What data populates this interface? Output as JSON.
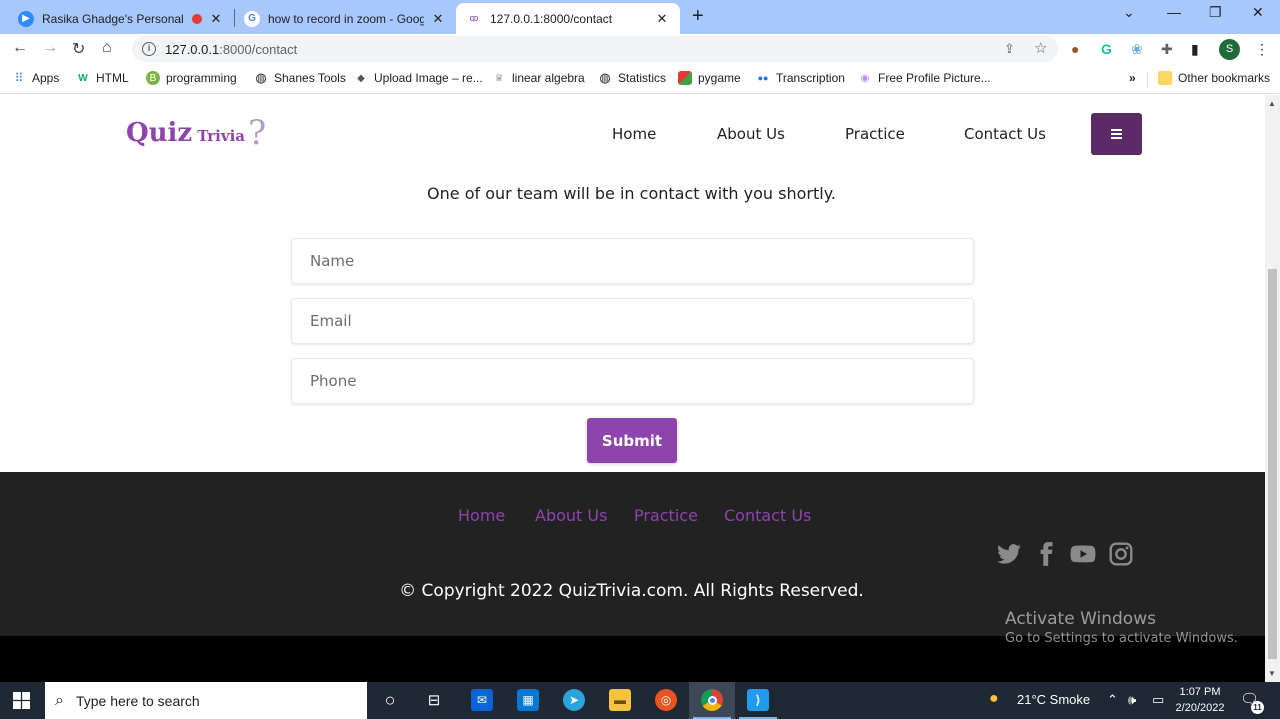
{
  "browser": {
    "tabs": [
      {
        "title": "Rasika Ghadge's Personal Me",
        "icon": "zoom-icon"
      },
      {
        "title": "how to record in zoom - Google",
        "icon": "google-icon"
      },
      {
        "title": "127.0.0.1:8000/contact",
        "icon": "site-favicon",
        "active": true
      }
    ],
    "new_tab": "+",
    "url_host": "127.0.0.1",
    "url_path": ":8000/contact",
    "profile_initial": "S",
    "bookmarks": [
      {
        "label": "Apps",
        "icon": "apps-grid-icon"
      },
      {
        "label": "HTML",
        "icon": "w3-icon"
      },
      {
        "label": "programming",
        "icon": "b-icon"
      },
      {
        "label": "Shanes Tools",
        "icon": "globe-icon"
      },
      {
        "label": "Upload Image – re...",
        "icon": "upload-icon"
      },
      {
        "label": "linear algebra",
        "icon": "crown-icon"
      },
      {
        "label": "Statistics",
        "icon": "globe-icon"
      },
      {
        "label": "pygame",
        "icon": "pygame-icon"
      },
      {
        "label": "Transcription",
        "icon": "otter-icon"
      },
      {
        "label": "Free Profile Picture...",
        "icon": "profile-pic-icon"
      }
    ],
    "more_bookmarks": "»",
    "other_bookmarks": "Other bookmarks"
  },
  "site": {
    "logo_main": "Quiz",
    "logo_sub": "Trivia",
    "nav": [
      "Home",
      "About Us",
      "Practice",
      "Contact Us"
    ],
    "intro": "One of our team will be in contact with you shortly.",
    "form": {
      "name_placeholder": "Name",
      "email_placeholder": "Email",
      "phone_placeholder": "Phone",
      "submit": "Submit"
    },
    "footer": {
      "links": [
        "Home",
        "About Us",
        "Practice",
        "Contact Us"
      ],
      "social": [
        "twitter-icon",
        "facebook-icon",
        "youtube-icon",
        "instagram-icon"
      ],
      "copyright": "© Copyright 2022 QuizTrivia.com. All Rights Reserved."
    },
    "brand_color": "#8e44ad",
    "menu_color": "#5b2a67",
    "footer_bg": "#222222"
  },
  "watermark": {
    "title": "Activate Windows",
    "subtitle": "Go to Settings to activate Windows."
  },
  "taskbar": {
    "search_placeholder": "Type here to search",
    "weather": "21°C  Smoke",
    "time": "1:07 PM",
    "date": "2/20/2022",
    "notifications": "11"
  }
}
